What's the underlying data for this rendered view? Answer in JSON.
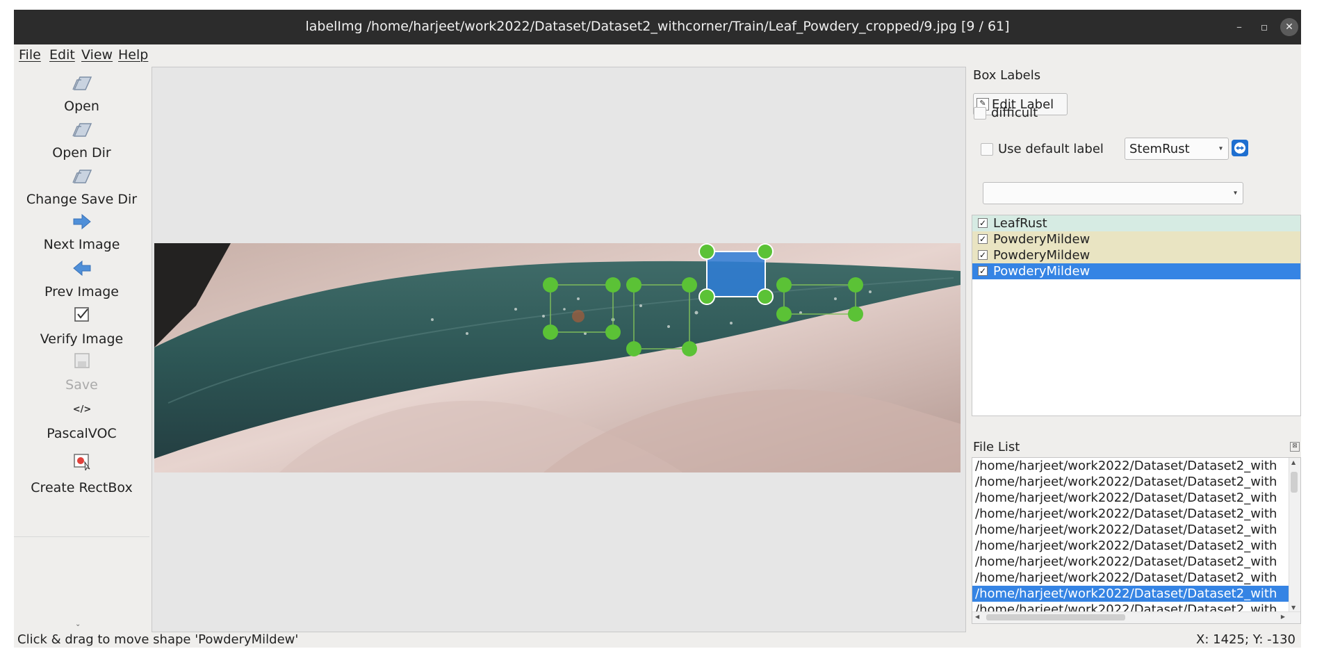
{
  "window": {
    "title": "labelImg /home/harjeet/work2022/Dataset/Dataset2_withcorner/Train/Leaf_Powdery_cropped/9.jpg [9 / 61]",
    "minimize_icon": "minimize-icon",
    "maximize_icon": "maximize-icon",
    "close_icon": "close-icon"
  },
  "menu": [
    {
      "label": "File"
    },
    {
      "label": "Edit"
    },
    {
      "label": "View"
    },
    {
      "label": "Help"
    }
  ],
  "toolbar": [
    {
      "label": "Open",
      "icon": "folder-open-icon"
    },
    {
      "label": "Open Dir",
      "icon": "folder-open-icon"
    },
    {
      "label": "Change Save Dir",
      "icon": "folder-open-icon"
    },
    {
      "label": "Next Image",
      "icon": "arrow-right-icon"
    },
    {
      "label": "Prev Image",
      "icon": "arrow-left-icon"
    },
    {
      "label": "Verify Image",
      "icon": "checkbox-icon"
    },
    {
      "label": "Save",
      "icon": "save-icon",
      "disabled": true
    },
    {
      "label": "PascalVOC",
      "icon": "code-icon"
    },
    {
      "label": "Create RectBox",
      "icon": "rectbox-icon"
    }
  ],
  "right_panel": {
    "box_labels_title": "Box Labels",
    "edit_label_button": "Edit Label",
    "difficult_label": "difficult",
    "use_default_label": "Use default label",
    "default_label_value": "StemRust",
    "label_filter_value": "",
    "labels": [
      {
        "text": "LeafRust",
        "checked": true,
        "color": "#d6ebe3"
      },
      {
        "text": "PowderyMildew",
        "checked": true,
        "color": "#e9e4c2"
      },
      {
        "text": "PowderyMildew",
        "checked": true,
        "color": "#e9e4c2"
      },
      {
        "text": "PowderyMildew",
        "checked": true,
        "color": "#3584e4",
        "selected": true
      }
    ],
    "file_list_title": "File List",
    "files": [
      {
        "path": "/home/harjeet/work2022/Dataset/Dataset2_with"
      },
      {
        "path": "/home/harjeet/work2022/Dataset/Dataset2_with"
      },
      {
        "path": "/home/harjeet/work2022/Dataset/Dataset2_with"
      },
      {
        "path": "/home/harjeet/work2022/Dataset/Dataset2_with"
      },
      {
        "path": "/home/harjeet/work2022/Dataset/Dataset2_with"
      },
      {
        "path": "/home/harjeet/work2022/Dataset/Dataset2_with"
      },
      {
        "path": "/home/harjeet/work2022/Dataset/Dataset2_with"
      },
      {
        "path": "/home/harjeet/work2022/Dataset/Dataset2_with"
      },
      {
        "path": "/home/harjeet/work2022/Dataset/Dataset2_with",
        "selected": true
      },
      {
        "path": "/home/harjeet/work2022/Dataset/Dataset2_with"
      }
    ]
  },
  "status": {
    "message": "Click & drag to move shape 'PowderyMildew'",
    "coords": "X: 1425; Y: -130"
  },
  "colors": {
    "accent": "#3584e4",
    "handle_green": "#5bc236",
    "leaf": "#2f5a57"
  }
}
